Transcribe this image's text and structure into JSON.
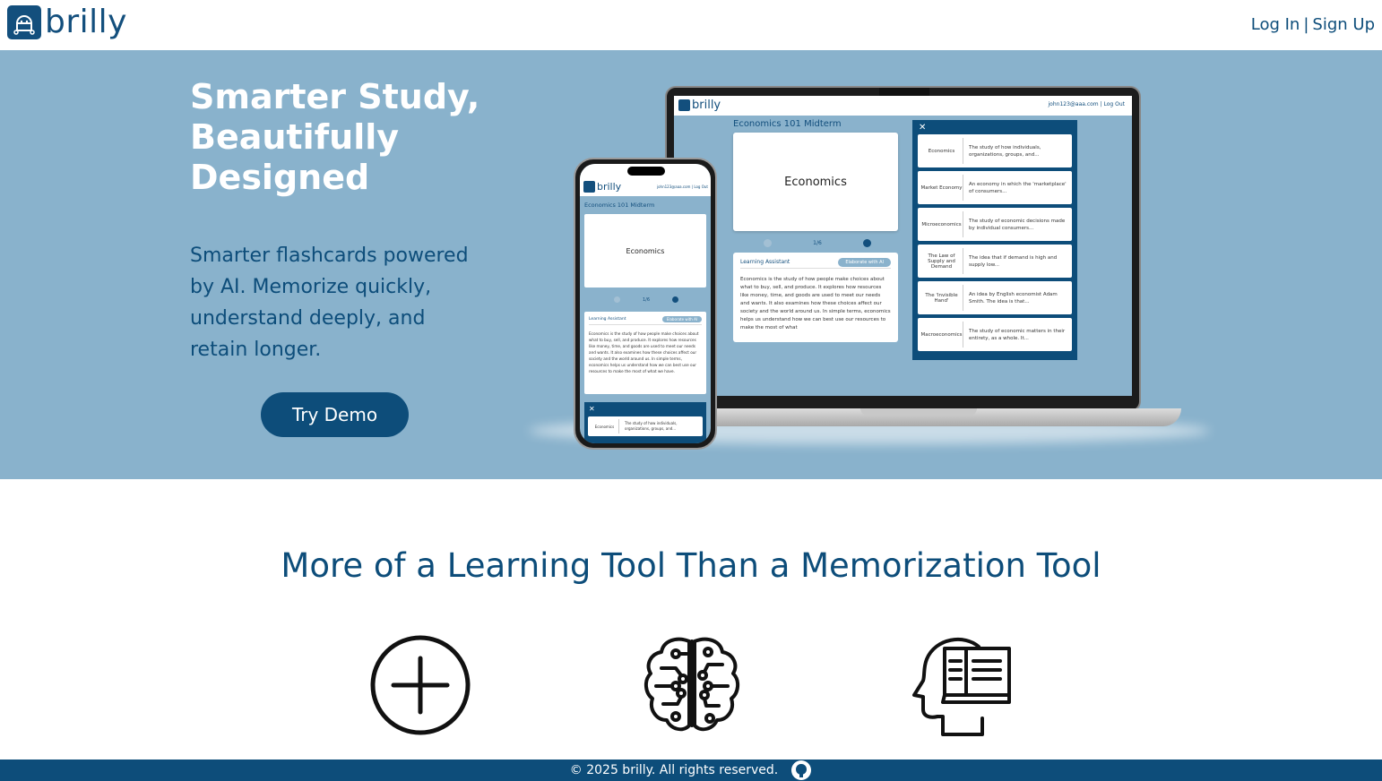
{
  "header": {
    "logo_text": "brilly",
    "login_label": "Log In",
    "separator": "|",
    "signup_label": "Sign Up"
  },
  "hero": {
    "title_lines": [
      "Smarter Study,",
      "Beautifully",
      "Designed"
    ],
    "subtitle": "Smarter flashcards powered by AI. Memorize quickly, understand deeply, and retain longer.",
    "cta_label": "Try Demo"
  },
  "mockup": {
    "logo_text": "brilly",
    "account_text": "john123@aaa.com | Log Out",
    "deck_title": "Economics 101 Midterm",
    "card_term": "Economics",
    "progress": "1/6",
    "assistant_label": "Learning Assistant",
    "elaborate_label": "Elaborate with AI",
    "assistant_text": "Economics is the study of how people make choices about what to buy, sell, and produce. It explores how resources like money, time, and goods are used to meet our needs and wants. It also examines how these choices affect our society and the world around us. In simple terms, economics helps us understand how we can best use our resources to make the most of what",
    "phone_assistant_text": "Economics is the study of how people make choices about what to buy, sell, and produce. It explores how resources like money, time, and goods are used to meet our needs and wants. It also examines how these choices affect our society and the world around us. In simple terms, economics helps us understand how we can best use our resources to make the most of what we have.",
    "terms": [
      {
        "term": "Economics",
        "definition": "The study of how individuals, organizations, groups, and..."
      },
      {
        "term": "Market Economy",
        "definition": "An economy in which the 'marketplace' of consumers..."
      },
      {
        "term": "Microeconomics",
        "definition": "The study of economic decisions made by individual consumers..."
      },
      {
        "term": "The Law of Supply and Demand",
        "definition": "The idea that if demand is high and supply low..."
      },
      {
        "term": "The 'Invisible Hand'",
        "definition": "An idea by English economist Adam Smith. The idea is that..."
      },
      {
        "term": "Macroeconomics",
        "definition": "The study of economic matters in their entirety, as a whole. It..."
      }
    ],
    "phone_term": {
      "term": "Economics",
      "definition": "The study of how individuals, organizations, groups, and..."
    }
  },
  "features": {
    "title": "More of a Learning Tool Than a Memorization Tool",
    "icons": [
      "plus-circle-icon",
      "brain-circuit-icon",
      "head-book-icon"
    ]
  },
  "footer": {
    "copyright": "© 2025 brilly. All rights reserved.",
    "github_icon": "github-icon"
  },
  "colors": {
    "brand": "#0d4d7a",
    "hero_bg": "#89b2cc",
    "white": "#ffffff"
  }
}
